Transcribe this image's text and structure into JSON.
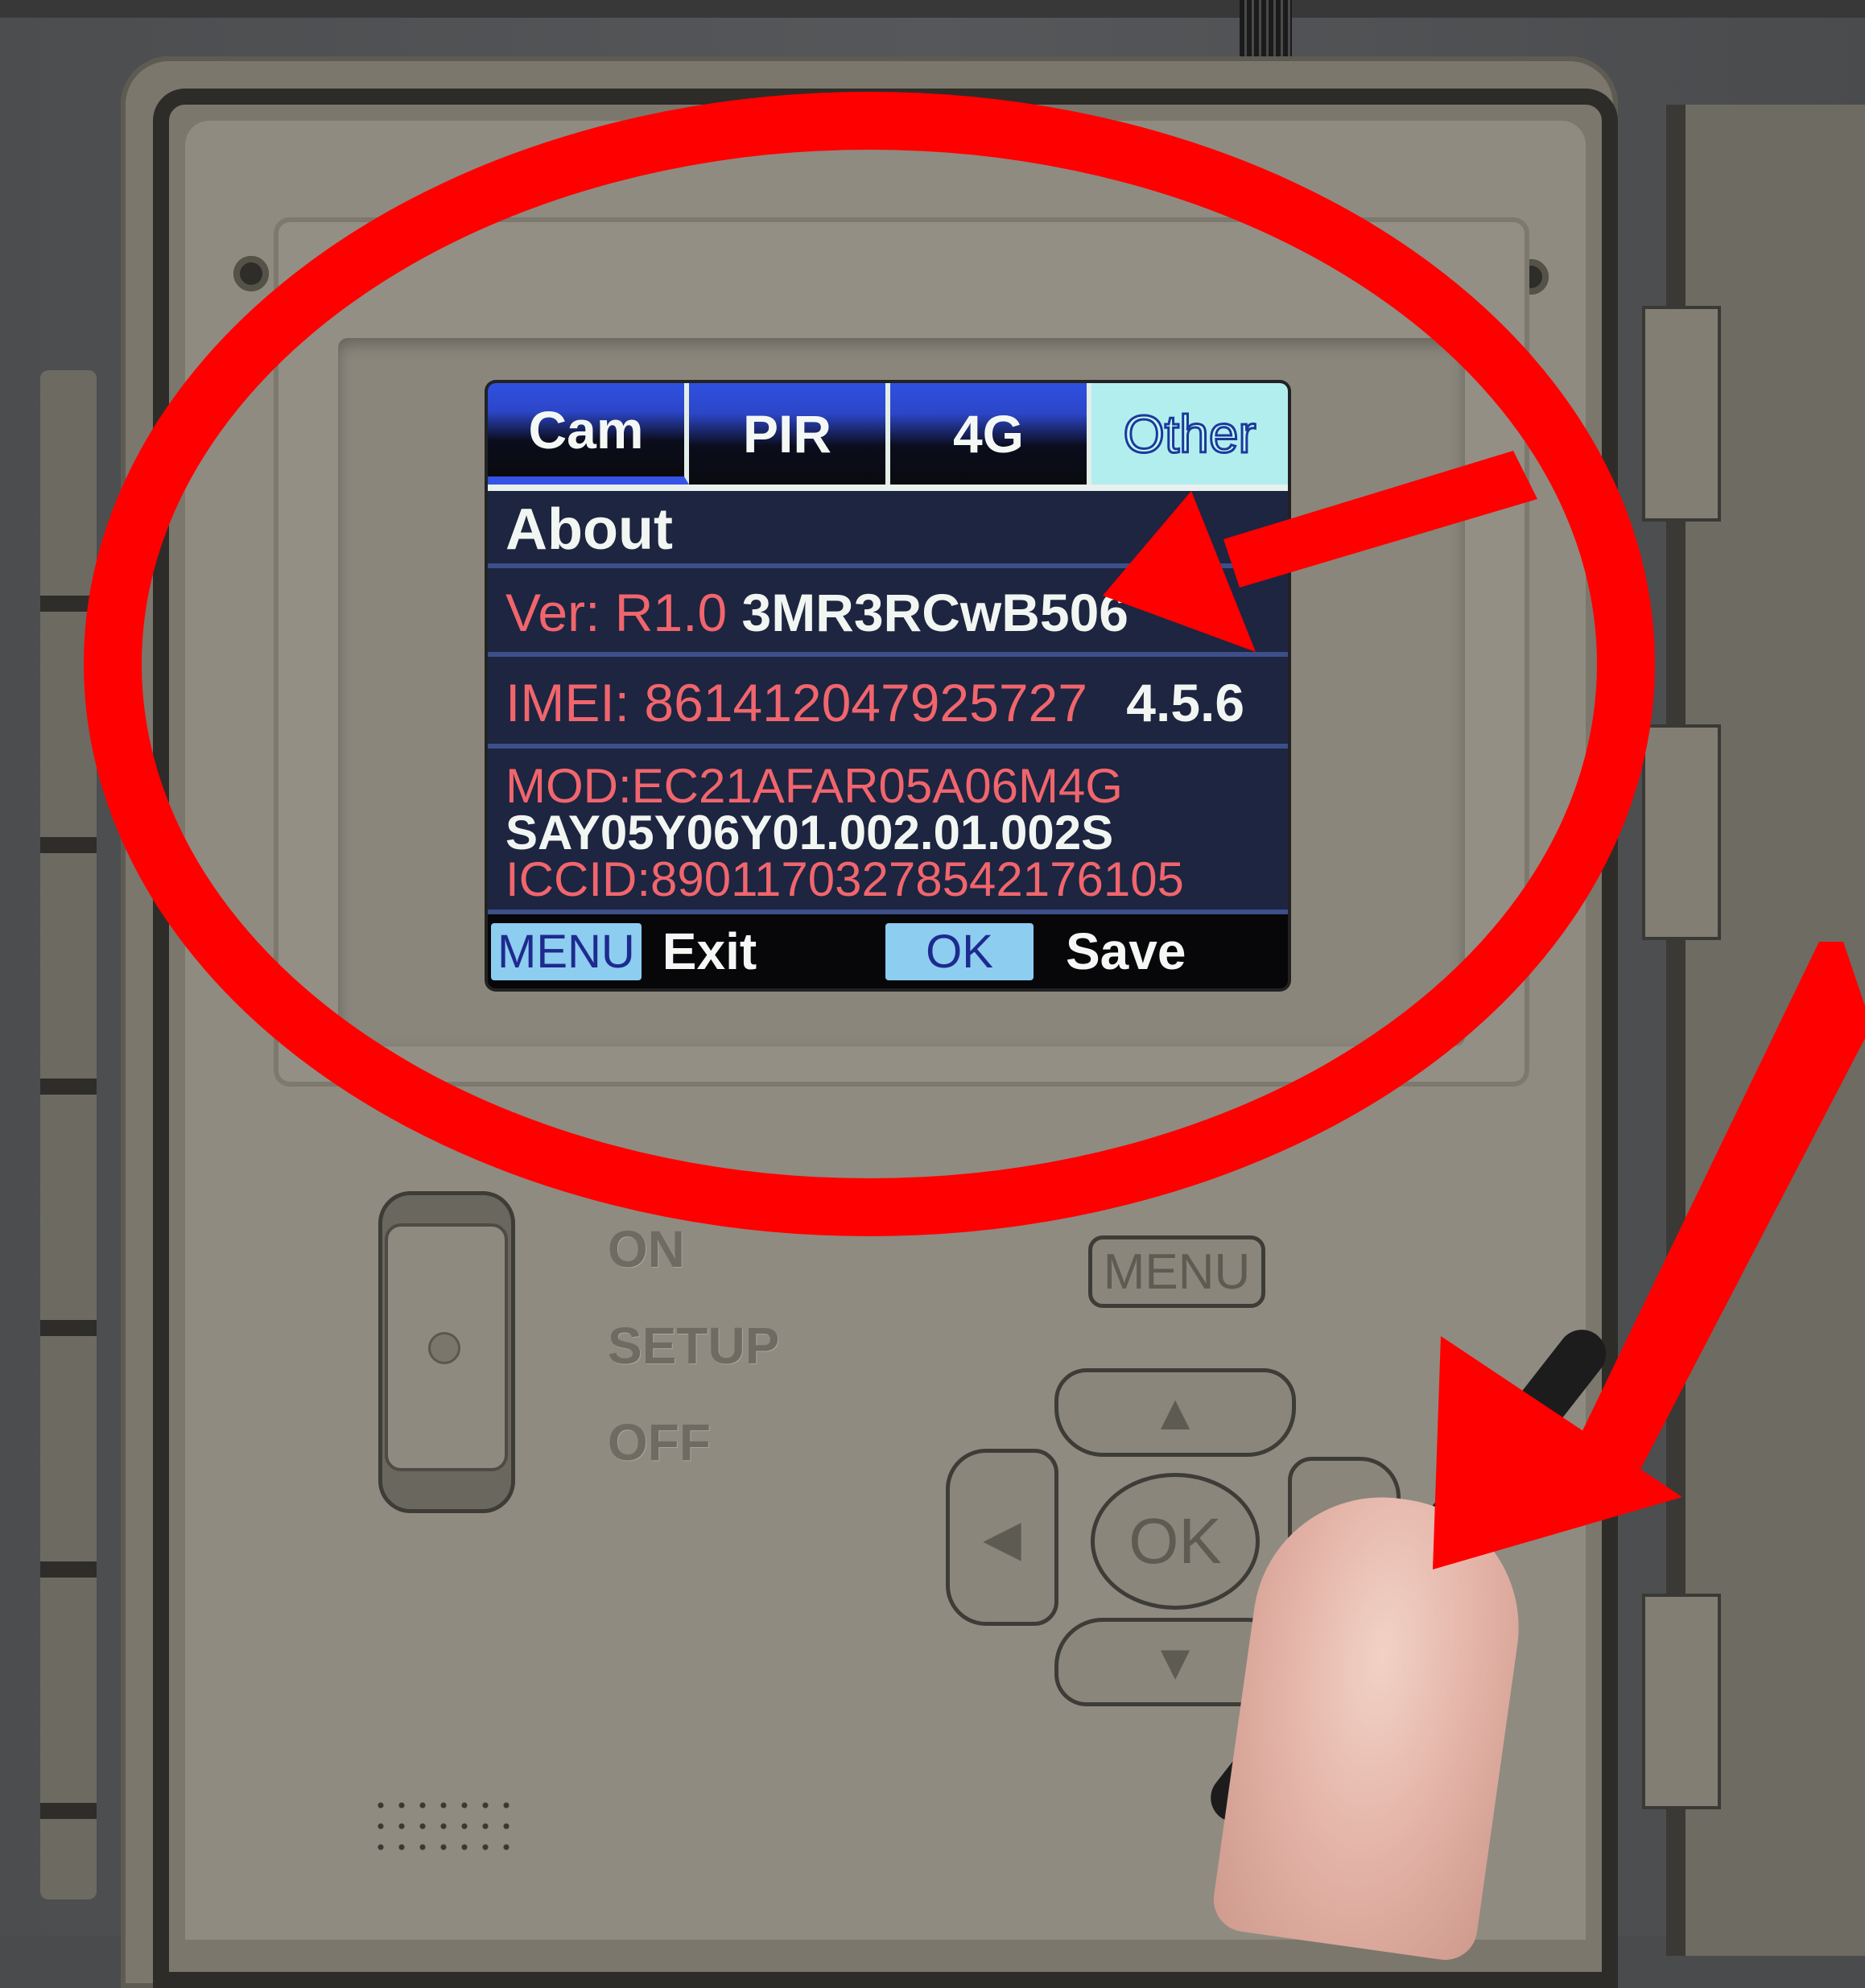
{
  "screen": {
    "tabs": [
      {
        "label": "Cam",
        "active": false
      },
      {
        "label": "PIR",
        "active": false
      },
      {
        "label": "4G",
        "active": false
      },
      {
        "label": "Other",
        "active": true
      }
    ],
    "section_title": "About",
    "version": {
      "label": "Ver: R1.0",
      "value": "3MR3RCwB506"
    },
    "imei": {
      "label": "IMEI:",
      "value": "861412047925727",
      "extra": "4.5.6"
    },
    "module": {
      "label": "MOD:",
      "value": "EC21AFAR05A06M4G"
    },
    "firmware": "SAY05Y06Y01.002.01.002S",
    "iccid": {
      "label": "ICCID:",
      "value": "89011703278542176105"
    },
    "footer": {
      "menu_key": "MENU",
      "menu_action": "Exit",
      "ok_key": "OK",
      "ok_action": "Save"
    }
  },
  "device": {
    "switch_positions": [
      "ON",
      "SETUP",
      "OFF"
    ],
    "menu_button": "MENU",
    "ok_button": "OK",
    "nav_icons": [
      "arrow-up-icon",
      "arrow-down-icon",
      "arrow-left-icon",
      "arrow-right-icon"
    ]
  },
  "annotations": {
    "color": "#ff0000",
    "items": [
      "highlight-circle-screen",
      "arrow-to-version",
      "arrow-to-right-button"
    ]
  },
  "colors": {
    "tab_active_bg": "#b2eeee",
    "tab_gradient_top": "#2f50e0",
    "label_red": "#f1656d",
    "key_bg": "#8dcdf0",
    "screen_bg": "#1d2540"
  }
}
